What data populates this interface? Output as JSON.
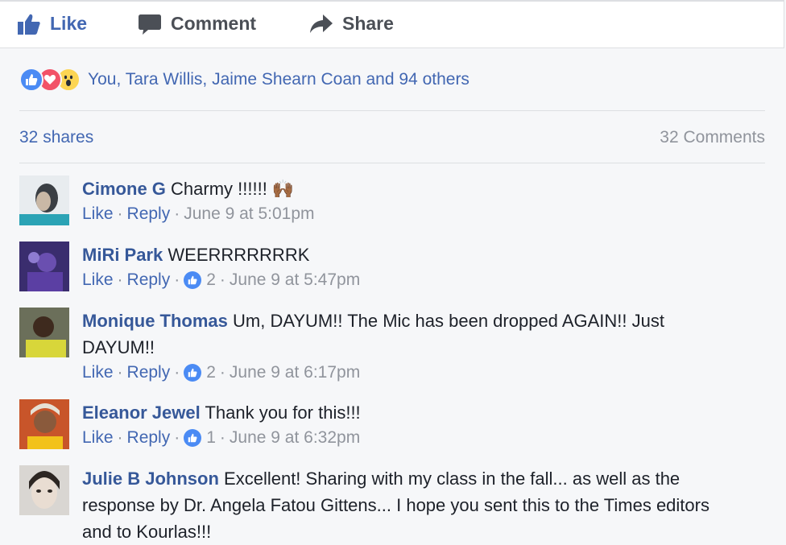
{
  "actions": {
    "like": "Like",
    "comment": "Comment",
    "share": "Share"
  },
  "reactions": {
    "icons": [
      "like-reaction-icon",
      "love-reaction-icon",
      "wow-reaction-icon"
    ],
    "text": "You, Tara Willis, Jaime Shearn Coan and 94 others"
  },
  "stats": {
    "shares": "32 shares",
    "comments": "32 Comments"
  },
  "meta_labels": {
    "like": "Like",
    "reply": "Reply",
    "dot": "·"
  },
  "comments": [
    {
      "author": "Cimone G",
      "text": " Charmy !!!!!! 🙌🏾",
      "likes": "",
      "time": "June 9 at 5:01pm"
    },
    {
      "author": "MiRi Park",
      "text": " WEERRRRRRRK",
      "likes": "2",
      "time": "June 9 at 5:47pm"
    },
    {
      "author": "Monique Thomas",
      "text": " Um, DAYUM!! The Mic has been dropped AGAIN!! Just DAYUM!!",
      "likes": "2",
      "time": "June 9 at 6:17pm"
    },
    {
      "author": "Eleanor Jewel",
      "text": " Thank you for this!!!",
      "likes": "1",
      "time": "June 9 at 6:32pm"
    },
    {
      "author": "Julie B Johnson",
      "text": " Excellent! Sharing with my class in the fall... as well as the response by Dr. Angela Fatou Gittens... I hope you sent this to the Times editors and to Kourlas!!!",
      "likes": "",
      "time": ""
    }
  ]
}
